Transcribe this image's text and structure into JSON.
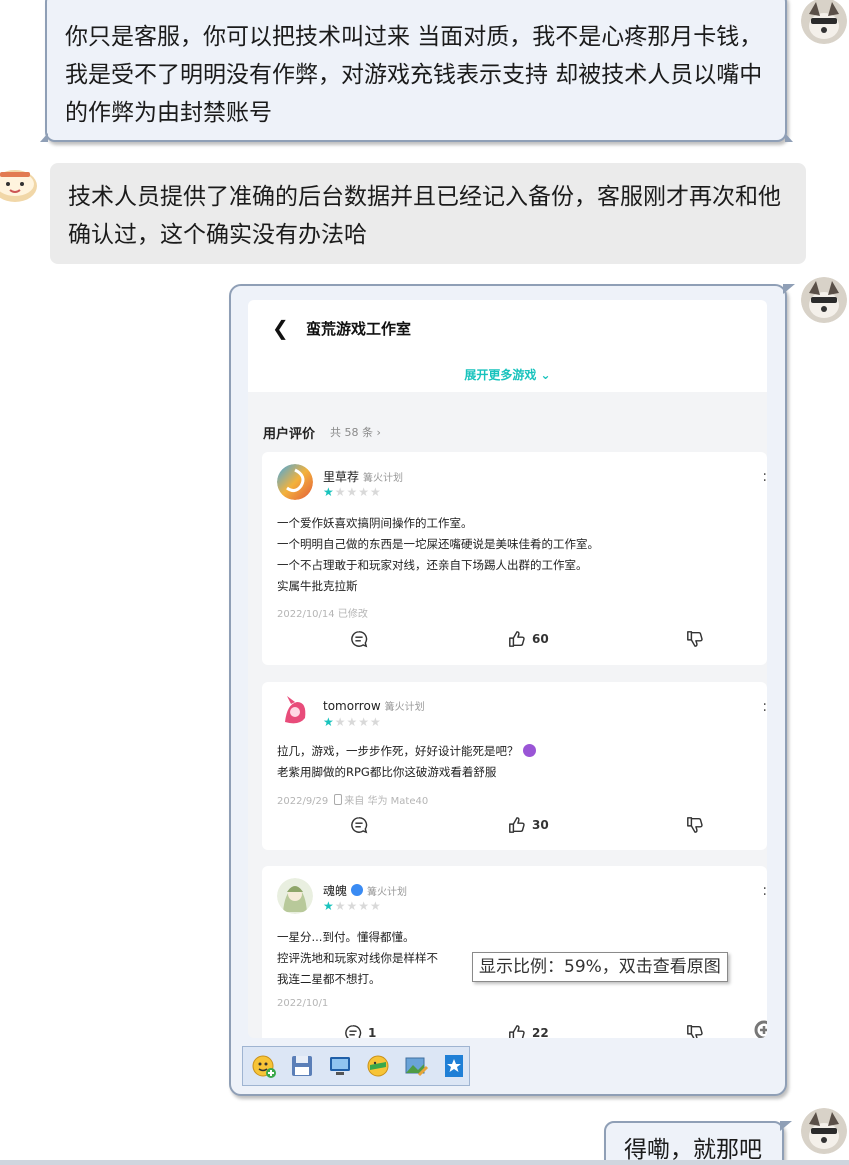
{
  "chat": {
    "messages": [
      {
        "side": "right",
        "text": "你只是客服，你可以把技术叫过来 当面对质，我不是心疼那月卡钱，我是受不了明明没有作弊，对游戏充钱表示支持 却被技术人员以嘴中的作弊为由封禁账号"
      },
      {
        "side": "left",
        "text": "技术人员提供了准确的后台数据并且已经记入备份，客服刚才再次和他确认过，这个确实没有办法哈"
      },
      {
        "side": "right",
        "text": "得嘞，就那吧"
      }
    ],
    "tooltip": "显示比例：59%，双击查看原图"
  },
  "screenshot": {
    "studio_title": "蛮荒游戏工作室",
    "expand_more": "展开更多游戏 ⌄",
    "reviews_title": "用户评价",
    "reviews_count": "共 58 条 ›",
    "reviews": [
      {
        "user": "里草荐",
        "tag": "篝火计划",
        "rating": 1,
        "lines": [
          "一个爱作妖喜欢搞阴间操作的工作室。",
          "一个明明自己做的东西是一坨屎还嘴硬说是美味佳肴的工作室。",
          "一个不占理敢于和玩家对线，还亲自下场踢人出群的工作室。",
          "实属牛批克拉斯"
        ],
        "meta": "2022/10/14 已修改",
        "device": "",
        "comments": "",
        "likes": "60"
      },
      {
        "user": "tomorrow",
        "tag": "篝火计划",
        "rating": 1,
        "lines": [
          "拉几，游戏，一步步作死，好好设计能死是吧？",
          "老紫用脚做的RPG都比你这破游戏看着舒服"
        ],
        "meta": "2022/9/29",
        "device": "来自 华为 Mate40",
        "comments": "",
        "likes": "30"
      },
      {
        "user": "魂魄",
        "tag": "篝火计划",
        "rating": 1,
        "lines": [
          "一星分...到付。懂得都懂。",
          "控评洗地和玩家对线你是样样不",
          "我连二星都不想打。"
        ],
        "meta": "2022/10/1",
        "device": "",
        "comments": "1",
        "likes": "22"
      }
    ]
  },
  "icons": {
    "back": "chevron-left-icon",
    "more": "more-vertical-icon",
    "comment": "comment-icon",
    "like": "thumbs-up-icon",
    "dislike": "thumbs-down-icon",
    "zoom": "zoom-in-icon",
    "toolbar": [
      "emoji-add-icon",
      "save-icon",
      "screen-icon",
      "sticker-icon",
      "image-edit-icon",
      "favorite-icon"
    ]
  },
  "colors": {
    "accent": "#19c3bd",
    "bubble_right": "#eef2f9",
    "bubble_left": "#ebebeb",
    "bubble_border": "#8f9fb6"
  }
}
